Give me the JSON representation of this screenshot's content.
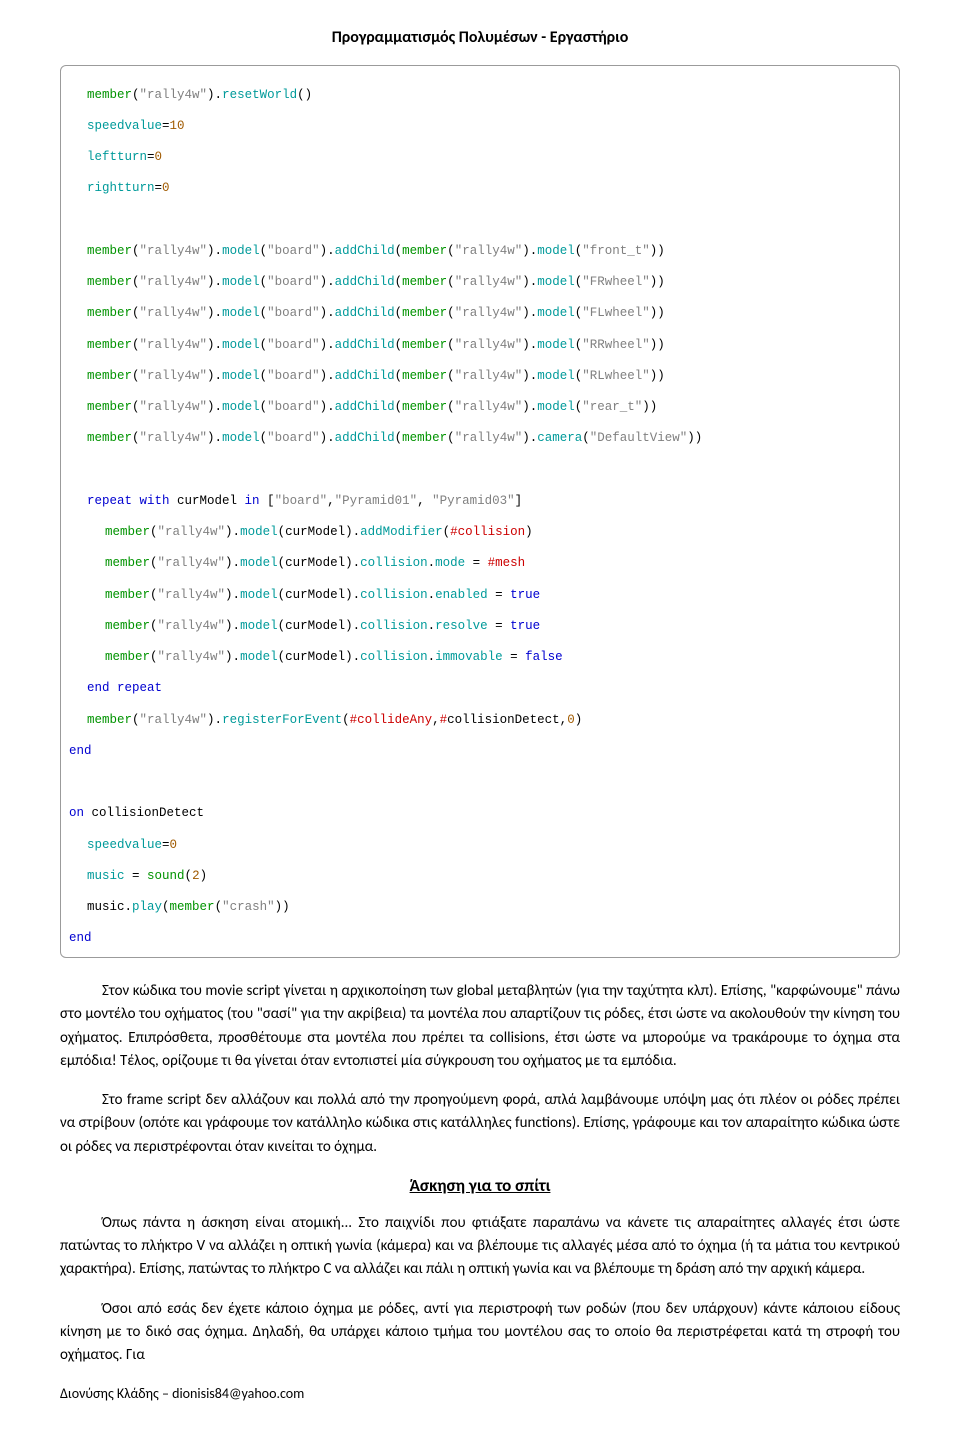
{
  "header": {
    "title": "Προγραμματισμός Πολυμέσων - Εργαστήριο"
  },
  "code": {
    "l01a": "member",
    "l01b": "(",
    "l01c": "\"rally4w\"",
    "l01d": ").",
    "l01e": "resetWorld",
    "l01f": "()",
    "l02a": "speedvalue",
    "l02b": "=",
    "l02c": "10",
    "l03a": "leftturn",
    "l03b": "=",
    "l03c": "0",
    "l04a": "rightturn",
    "l04b": "=",
    "l04c": "0",
    "l06a": "member",
    "l06b": "(",
    "l06c": "\"rally4w\"",
    "l06d": ").",
    "l06e": "model",
    "l06f": "(",
    "l06g": "\"board\"",
    "l06h": ").",
    "l06i": "addChild",
    "l06j": "(",
    "l06k": "member",
    "l06l": "(",
    "l06m": "\"rally4w\"",
    "l06n": ").",
    "l06o": "model",
    "l06p": "(",
    "l06q": "\"front_t\"",
    "l06r": "))",
    "l07q": "\"FRwheel\"",
    "l08q": "\"FLwheel\"",
    "l09q": "\"RRwheel\"",
    "l10q": "\"RLwheel\"",
    "l11q": "\"rear_t\"",
    "l12o": "camera",
    "l12q": "\"DefaultView\"",
    "l14a": "repeat with",
    "l14b": " curModel ",
    "l14c": "in",
    "l14d": " [",
    "l14e": "\"board\"",
    "l14f": ",",
    "l14g": "\"Pyramid01\"",
    "l14h": ", ",
    "l14i": "\"Pyramid03\"",
    "l14j": "]",
    "l15a": "member",
    "l15b": "(",
    "l15c": "\"rally4w\"",
    "l15d": ").",
    "l15e": "model",
    "l15f": "(curModel).",
    "l15g": "addModifier",
    "l15h": "(",
    "l15i": "#collision",
    "l15j": ")",
    "l16g": "collision",
    "l16h": ".",
    "l16i": "mode",
    "l16j": " = ",
    "l16k": "#mesh",
    "l17i": "enabled",
    "l17k": "true",
    "l18i": "resolve",
    "l19i": "immovable",
    "l19k": "false",
    "l20a": "end repeat",
    "l21e": "registerForEvent",
    "l21g": "#collideAny",
    "l21h": ",",
    "l21i": "#",
    "l21j": "collisionDetect,",
    "l21k": "0",
    "l21l": ")",
    "l22a": "end",
    "l24a": "on",
    "l24b": " collisionDetect",
    "l25a": "speedvalue",
    "l25b": "=",
    "l25c": "0",
    "l26a": "music",
    "l26b": " = ",
    "l26c": "sound",
    "l26d": "(",
    "l26e": "2",
    "l26f": ")",
    "l27a": "music.",
    "l27b": "play",
    "l27c": "(",
    "l27d": "member",
    "l27e": "(",
    "l27f": "\"crash\"",
    "l27g": "))",
    "l28a": "end",
    "blank": " "
  },
  "paragraphs": {
    "p1": "Στον κώδικα του movie script γίνεται η αρχικοποίηση των global μεταβλητών (για την ταχύτητα κλπ). Επίσης, \"καρφώνουμε\" πάνω στο μοντέλο του οχήματος (του \"σασί\" για την ακρίβεια) τα μοντέλα που απαρτίζουν τις ρόδες, έτσι ώστε να ακολουθούν την κίνηση του οχήματος. Επιπρόσθετα, προσθέτουμε στα μοντέλα που πρέπει τα collisions, έτσι ώστε να μπορούμε να τρακάρουμε το όχημα στα εμπόδια! Τέλος, ορίζουμε τι θα γίνεται όταν εντοπιστεί μία σύγκρουση του οχήματος με τα εμπόδια.",
    "p2": "Στο frame script δεν αλλάζουν και πολλά από την προηγούμενη φορά, απλά λαμβάνουμε υπόψη μας ότι πλέον οι ρόδες πρέπει να στρίβουν (οπότε και γράφουμε τον κατάλληλο κώδικα στις κατάλληλες functions). Επίσης, γράφουμε και τον απαραίτητο κώδικα ώστε οι ρόδες να περιστρέφονται όταν κινείται το όχημα.",
    "p3": "Όπως πάντα η άσκηση είναι ατομική... Στο παιχνίδι που φτιάξατε παραπάνω να κάνετε τις απαραίτητες αλλαγές έτσι ώστε  πατώντας το πλήκτρο V να αλλάζει η οπτική γωνία (κάμερα) και να βλέπουμε τις αλλαγές μέσα από το όχημα (ή τα μάτια του κεντρικού χαρακτήρα). Επίσης, πατώντας το πλήκτρο C να αλλάζει και πάλι η οπτική γωνία και να βλέπουμε τη δράση από την αρχική κάμερα.",
    "p4": "Όσοι από εσάς δεν έχετε κάποιο όχημα με ρόδες, αντί για περιστροφή των ροδών (που δεν υπάρχουν) κάντε κάποιου είδους κίνηση με το δικό σας όχημα. Δηλαδή, θα υπάρχει κάποιο τμήμα του μοντέλου σας το οποίο θα περιστρέφεται κατά τη στροφή του οχήματος. Για"
  },
  "section": {
    "title": "Άσκηση για το σπίτι"
  },
  "footer": {
    "text": "Διονύσης Κλάδης – dionisis84@yahoo.com"
  }
}
